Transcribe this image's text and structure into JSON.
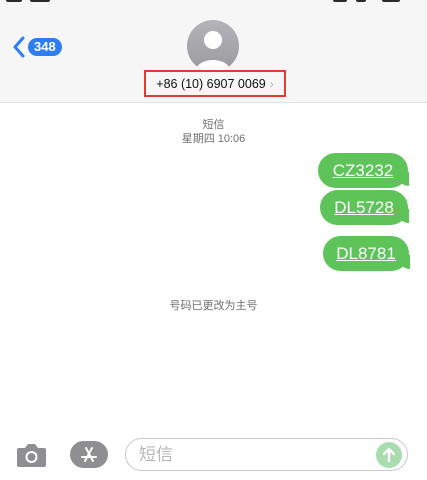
{
  "header": {
    "badge_count": "348",
    "contact_number": "+86 (10) 6907 0069",
    "contact_chevron": "›"
  },
  "thread": {
    "service_label": "短信",
    "timestamp": "星期四 10:06",
    "messages": [
      {
        "text": "CZ3232"
      },
      {
        "text": "DL5728"
      },
      {
        "text": "DL8781"
      }
    ],
    "notice": "号码已更改为主号"
  },
  "composer": {
    "placeholder": "短信"
  },
  "icons": {
    "back": "chevron-left-icon",
    "avatar": "person-icon",
    "camera": "camera-icon",
    "appstore": "app-store-icon",
    "send": "arrow-up-icon"
  },
  "colors": {
    "accent": "#2f7df6",
    "bubble": "#5ec45a",
    "highlight_box": "#e53935"
  }
}
